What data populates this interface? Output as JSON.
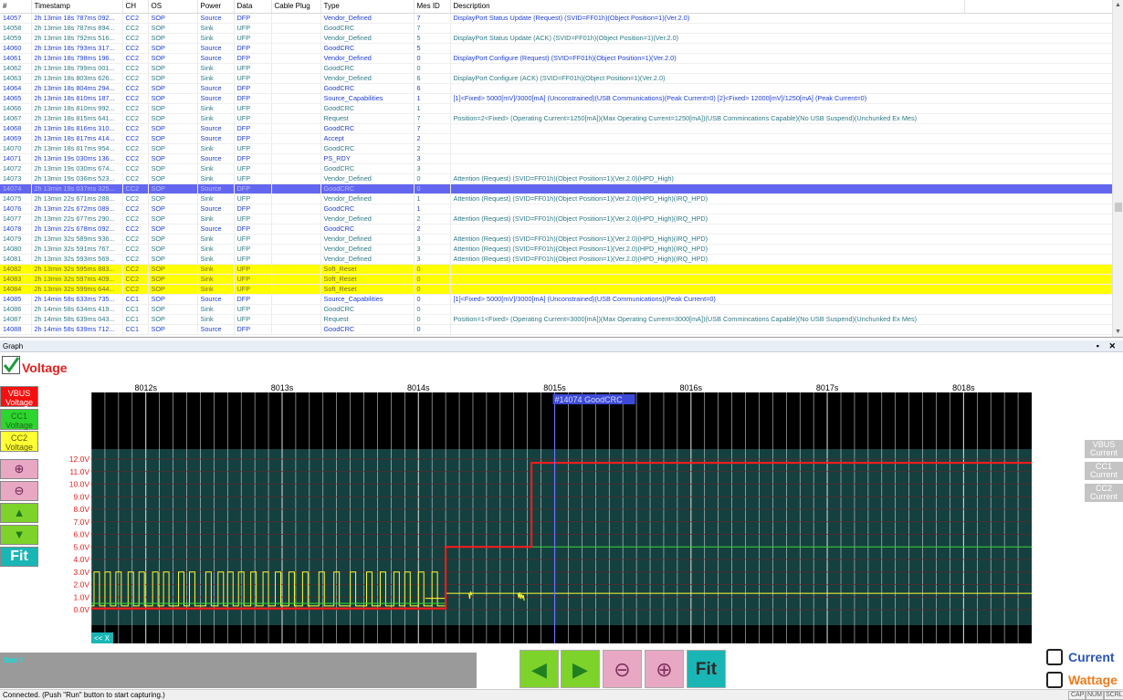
{
  "table": {
    "columns": [
      "#",
      "Timestamp",
      "CH",
      "OS",
      "Power",
      "Data",
      "Cable Plug",
      "Type",
      "Mes ID",
      "Description"
    ],
    "rows": [
      {
        "n": "14057",
        "ts": "2h 13min 18s 787ms 092...",
        "ch": "CC2",
        "os": "SOP",
        "power": "Source",
        "data": "DFP",
        "plug": "",
        "type": "Vendor_Defined",
        "mid": "7",
        "desc": "DisplayPort Status Update (Request) (SVID=FF01h)(Object Position=1)(Ver.2.0)",
        "style": "c-blue"
      },
      {
        "n": "14058",
        "ts": "2h 13min 18s 787ms 894...",
        "ch": "CC2",
        "os": "SOP",
        "power": "Sink",
        "data": "UFP",
        "plug": "",
        "type": "GoodCRC",
        "mid": "7",
        "desc": "",
        "style": "c-teal"
      },
      {
        "n": "14059",
        "ts": "2h 13min 18s 792ms 516...",
        "ch": "CC2",
        "os": "SOP",
        "power": "Sink",
        "data": "UFP",
        "plug": "",
        "type": "Vendor_Defined",
        "mid": "5",
        "desc": "DisplayPort Status Update (ACK) (SVID=FF01h)(Object Position=1)(Ver.2.0)",
        "style": "c-teal"
      },
      {
        "n": "14060",
        "ts": "2h 13min 18s 793ms 317...",
        "ch": "CC2",
        "os": "SOP",
        "power": "Source",
        "data": "DFP",
        "plug": "",
        "type": "GoodCRC",
        "mid": "5",
        "desc": "",
        "style": "c-blue"
      },
      {
        "n": "14061",
        "ts": "2h 13min 18s 798ms 196...",
        "ch": "CC2",
        "os": "SOP",
        "power": "Source",
        "data": "DFP",
        "plug": "",
        "type": "Vendor_Defined",
        "mid": "0",
        "desc": "DisplayPort Configure (Request) (SVID=FF01h)(Object Position=1)(Ver.2.0)",
        "style": "c-blue"
      },
      {
        "n": "14062",
        "ts": "2h 13min 18s 799ms 001...",
        "ch": "CC2",
        "os": "SOP",
        "power": "Sink",
        "data": "UFP",
        "plug": "",
        "type": "GoodCRC",
        "mid": "0",
        "desc": "",
        "style": "c-teal"
      },
      {
        "n": "14063",
        "ts": "2h 13min 18s 803ms 626...",
        "ch": "CC2",
        "os": "SOP",
        "power": "Sink",
        "data": "UFP",
        "plug": "",
        "type": "Vendor_Defined",
        "mid": "6",
        "desc": "DisplayPort Configure (ACK) (SVID=FF01h)(Object Position=1)(Ver.2.0)",
        "style": "c-teal"
      },
      {
        "n": "14064",
        "ts": "2h 13min 18s 804ms 294...",
        "ch": "CC2",
        "os": "SOP",
        "power": "Source",
        "data": "DFP",
        "plug": "",
        "type": "GoodCRC",
        "mid": "6",
        "desc": "",
        "style": "c-blue"
      },
      {
        "n": "14065",
        "ts": "2h 13min 18s 810ms 187...",
        "ch": "CC2",
        "os": "SOP",
        "power": "Source",
        "data": "DFP",
        "plug": "",
        "type": "Source_Capabilities",
        "mid": "1",
        "desc": "[1]<Fixed> 5000[mV]/3000[mA] (Unconstrained)(USB Communications)(Peak Current=0) [2]<Fixed> 12000[mV]/1250[mA] (Peak Current=0)",
        "style": "c-blue"
      },
      {
        "n": "14066",
        "ts": "2h 13min 18s 810ms 992...",
        "ch": "CC2",
        "os": "SOP",
        "power": "Sink",
        "data": "UFP",
        "plug": "",
        "type": "GoodCRC",
        "mid": "1",
        "desc": "",
        "style": "c-teal"
      },
      {
        "n": "14067",
        "ts": "2h 13min 18s 815ms 641...",
        "ch": "CC2",
        "os": "SOP",
        "power": "Sink",
        "data": "UFP",
        "plug": "",
        "type": "Request",
        "mid": "7",
        "desc": "Position=2<Fixed> (Operating Current=1250[mA])(Max Operating Current=1250[mA])(USB Commincations Capable)(No USB Suspend)(Unchunked Ex Mes)",
        "style": "c-teal"
      },
      {
        "n": "14068",
        "ts": "2h 13min 18s 816ms 310...",
        "ch": "CC2",
        "os": "SOP",
        "power": "Source",
        "data": "DFP",
        "plug": "",
        "type": "GoodCRC",
        "mid": "7",
        "desc": "",
        "style": "c-blue"
      },
      {
        "n": "14069",
        "ts": "2h 13min 18s 817ms 414...",
        "ch": "CC2",
        "os": "SOP",
        "power": "Source",
        "data": "DFP",
        "plug": "",
        "type": "Accept",
        "mid": "2",
        "desc": "",
        "style": "c-blue"
      },
      {
        "n": "14070",
        "ts": "2h 13min 18s 817ms 954...",
        "ch": "CC2",
        "os": "SOP",
        "power": "Sink",
        "data": "UFP",
        "plug": "",
        "type": "GoodCRC",
        "mid": "2",
        "desc": "",
        "style": "c-teal"
      },
      {
        "n": "14071",
        "ts": "2h 13min 19s 030ms 136...",
        "ch": "CC2",
        "os": "SOP",
        "power": "Source",
        "data": "DFP",
        "plug": "",
        "type": "PS_RDY",
        "mid": "3",
        "desc": "",
        "style": "c-blue"
      },
      {
        "n": "14072",
        "ts": "2h 13min 19s 030ms 674...",
        "ch": "CC2",
        "os": "SOP",
        "power": "Sink",
        "data": "UFP",
        "plug": "",
        "type": "GoodCRC",
        "mid": "3",
        "desc": "",
        "style": "c-teal"
      },
      {
        "n": "14073",
        "ts": "2h 13min 19s 036ms 523...",
        "ch": "CC2",
        "os": "SOP",
        "power": "Sink",
        "data": "UFP",
        "plug": "",
        "type": "Vendor_Defined",
        "mid": "0",
        "desc": " Attention (Request) (SVID=FF01h)(Object Position=1)(Ver.2.0)(HPD_High)",
        "style": "c-teal"
      },
      {
        "n": "14074",
        "ts": "2h 13min 19s 037ms 325...",
        "ch": "CC2",
        "os": "SOP",
        "power": "Source",
        "data": "DFP",
        "plug": "",
        "type": "GoodCRC",
        "mid": "0",
        "desc": "",
        "style": "sel"
      },
      {
        "n": "14075",
        "ts": "2h 13min 22s 671ms 288...",
        "ch": "CC2",
        "os": "SOP",
        "power": "Sink",
        "data": "UFP",
        "plug": "",
        "type": "Vendor_Defined",
        "mid": "1",
        "desc": " Attention (Request) (SVID=FF01h)(Object Position=1)(Ver.2.0)(HPD_High)(IRQ_HPD)",
        "style": "c-teal"
      },
      {
        "n": "14076",
        "ts": "2h 13min 22s 672ms 089...",
        "ch": "CC2",
        "os": "SOP",
        "power": "Source",
        "data": "DFP",
        "plug": "",
        "type": "GoodCRC",
        "mid": "1",
        "desc": "",
        "style": "c-blue"
      },
      {
        "n": "14077",
        "ts": "2h 13min 22s 677ms 290...",
        "ch": "CC2",
        "os": "SOP",
        "power": "Sink",
        "data": "UFP",
        "plug": "",
        "type": "Vendor_Defined",
        "mid": "2",
        "desc": " Attention (Request) (SVID=FF01h)(Object Position=1)(Ver.2.0)(HPD_High)(IRQ_HPD)",
        "style": "c-teal"
      },
      {
        "n": "14078",
        "ts": "2h 13min 22s 678ms 092...",
        "ch": "CC2",
        "os": "SOP",
        "power": "Source",
        "data": "DFP",
        "plug": "",
        "type": "GoodCRC",
        "mid": "2",
        "desc": "",
        "style": "c-blue"
      },
      {
        "n": "14079",
        "ts": "2h 13min 32s 589ms 936...",
        "ch": "CC2",
        "os": "SOP",
        "power": "Sink",
        "data": "UFP",
        "plug": "",
        "type": "Vendor_Defined",
        "mid": "3",
        "desc": " Attention (Request) (SVID=FF01h)(Object Position=1)(Ver.2.0)(HPD_High)(IRQ_HPD)",
        "style": "c-teal"
      },
      {
        "n": "14080",
        "ts": "2h 13min 32s 591ms 767...",
        "ch": "CC2",
        "os": "SOP",
        "power": "Sink",
        "data": "UFP",
        "plug": "",
        "type": "Vendor_Defined",
        "mid": "3",
        "desc": " Attention (Request) (SVID=FF01h)(Object Position=1)(Ver.2.0)(HPD_High)(IRQ_HPD)",
        "style": "c-teal"
      },
      {
        "n": "14081",
        "ts": "2h 13min 32s 593ms 569...",
        "ch": "CC2",
        "os": "SOP",
        "power": "Sink",
        "data": "UFP",
        "plug": "",
        "type": "Vendor_Defined",
        "mid": "3",
        "desc": " Attention (Request) (SVID=FF01h)(Object Position=1)(Ver.2.0)(HPD_High)(IRQ_HPD)",
        "style": "c-teal"
      },
      {
        "n": "14082",
        "ts": "2h 13min 32s 595ms 883...",
        "ch": "CC2",
        "os": "SOP",
        "power": "Sink",
        "data": "UFP",
        "plug": "",
        "type": "Soft_Reset",
        "mid": "0",
        "desc": "",
        "style": "yel"
      },
      {
        "n": "14083",
        "ts": "2h 13min 32s 597ms 409...",
        "ch": "CC2",
        "os": "SOP",
        "power": "Sink",
        "data": "UFP",
        "plug": "",
        "type": "Soft_Reset",
        "mid": "0",
        "desc": "",
        "style": "yel"
      },
      {
        "n": "14084",
        "ts": "2h 13min 32s 599ms 644...",
        "ch": "CC2",
        "os": "SOP",
        "power": "Sink",
        "data": "UFP",
        "plug": "",
        "type": "Soft_Reset",
        "mid": "0",
        "desc": "",
        "style": "yel"
      },
      {
        "n": "14085",
        "ts": "2h 14min 58s 633ms 735...",
        "ch": "CC1",
        "os": "SOP",
        "power": "Source",
        "data": "DFP",
        "plug": "",
        "type": "Source_Capabilities",
        "mid": "0",
        "desc": "[1]<Fixed> 5000[mV]/3000[mA] (Unconstrained)(USB Communications)(Peak Current=0)",
        "style": "c-blue"
      },
      {
        "n": "14086",
        "ts": "2h 14min 58s 634ms 419...",
        "ch": "CC1",
        "os": "SOP",
        "power": "Sink",
        "data": "UFP",
        "plug": "",
        "type": "GoodCRC",
        "mid": "0",
        "desc": "",
        "style": "c-teal"
      },
      {
        "n": "14087",
        "ts": "2h 14min 58s 639ms 043...",
        "ch": "CC1",
        "os": "SOP",
        "power": "Sink",
        "data": "UFP",
        "plug": "",
        "type": "Request",
        "mid": "0",
        "desc": "Position=1<Fixed> (Operating Current=3000[mA])(Max Operating Current=3000[mA])(USB Commincations Capable)(No USB Suspend)(Unchunked Ex Mes)",
        "style": "c-teal"
      },
      {
        "n": "14088",
        "ts": "2h 14min 58s 639ms 712...",
        "ch": "CC1",
        "os": "SOP",
        "power": "Source",
        "data": "DFP",
        "plug": "",
        "type": "GoodCRC",
        "mid": "0",
        "desc": "",
        "style": "c-blue"
      }
    ]
  },
  "graph_panel": {
    "title": "Graph",
    "header_buttons": "▪ ✕"
  },
  "voltage": {
    "checked": true,
    "label": "Voltage",
    "check_mark": "✔"
  },
  "legend": {
    "vbus": "VBUS Voltage",
    "cc1": "CC1 Voltage",
    "cc2": "CC2 Voltage"
  },
  "tools": {
    "zoom_in": "⊕",
    "zoom_out": "⊖",
    "up": "▲",
    "down": "▼",
    "fit": "Fit"
  },
  "right_labels": {
    "vbus": "VBUS Current",
    "cc1": "CC1 Current",
    "cc2": "CC2 Current"
  },
  "chart_data": {
    "type": "line",
    "x_ticks": [
      "8012s",
      "8013s",
      "8014s",
      "8015s",
      "8016s",
      "8017s",
      "8018s"
    ],
    "y_ticks": [
      "12.0V",
      "11.0V",
      "10.0V",
      "9.0V",
      "8.0V",
      "7.0V",
      "6.0V",
      "5.0V",
      "4.0V",
      "3.0V",
      "2.0V",
      "1.0V",
      "0.0V"
    ],
    "ylim": [
      0,
      12
    ],
    "xlim": [
      8011.6,
      8018.5
    ],
    "cursor_label": "#14074 GoodCRC",
    "cursor_x": 8015.0,
    "xscale_label": "<< X",
    "colors": {
      "vbus": "#ff1a1a",
      "cc1": "#33dd33",
      "cc2": "#ffff33",
      "grid_fine": "#ffffff",
      "plot_bg": "#154040"
    },
    "series": [
      {
        "name": "VBUS Voltage",
        "x": [
          8011.6,
          8014.2,
          8014.2,
          8014.83,
          8014.83,
          8018.5
        ],
        "y": [
          0.1,
          0.1,
          5.0,
          5.0,
          11.7,
          11.7
        ]
      },
      {
        "name": "CC1 Voltage",
        "x": [
          8011.6,
          8014.2,
          8014.2,
          8018.5
        ],
        "y": [
          0.5,
          0.5,
          5.0,
          5.0
        ]
      },
      {
        "name": "CC2 Voltage",
        "x": [
          8011.6,
          8018.5
        ],
        "y": [
          1.3,
          1.3
        ]
      }
    ]
  },
  "status": {
    "dx": "D to X",
    "s": "0s",
    "ms": "0ms",
    "us": "0us"
  },
  "nav": {
    "prev": "◀",
    "next": "▶",
    "zoom_out": "⊖",
    "zoom_in": "⊕",
    "fit": "Fit"
  },
  "options": {
    "current": "Current",
    "wattage": "Wattage"
  },
  "footer": {
    "message": "Connected.  (Push \"Run\" button to start capturing.)",
    "cap": "CAP",
    "num": "NUM",
    "scrl": "SCRL"
  }
}
